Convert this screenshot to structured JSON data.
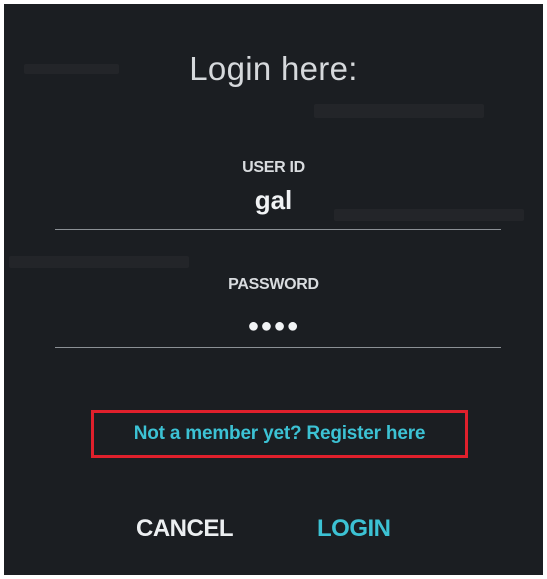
{
  "dialog": {
    "title": "Login here:",
    "user_id": {
      "label": "USER ID",
      "value": "gal"
    },
    "password": {
      "label": "PASSWORD",
      "value": "●●●●"
    },
    "register_link": "Not a member yet? Register here",
    "buttons": {
      "cancel": "CANCEL",
      "login": "LOGIN"
    }
  },
  "colors": {
    "background": "#1b1e22",
    "accent": "#3cc2d4",
    "highlight_border": "#e0202c",
    "text": "#eceff1"
  }
}
